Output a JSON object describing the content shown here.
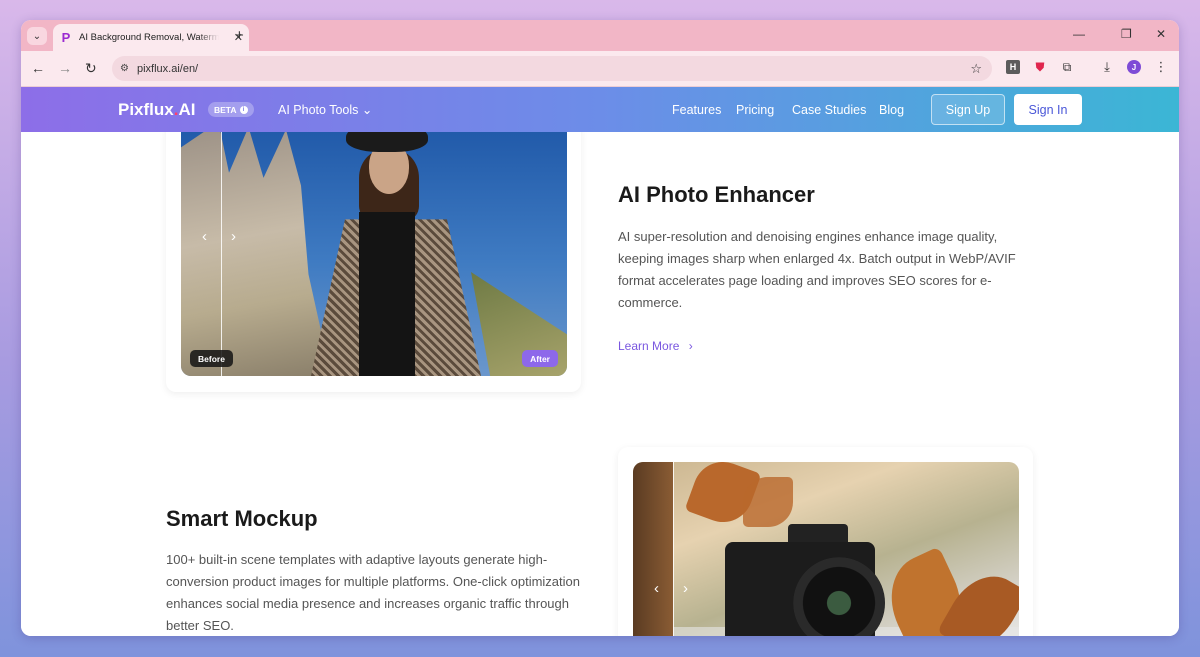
{
  "browser": {
    "tab_title": "AI Background Removal, Watermark",
    "tab_favicon": "P",
    "tab_close": "✕",
    "new_tab": "+",
    "url": "pixflux.ai/en/",
    "window_controls": {
      "minimize": "—",
      "restore": "❐",
      "close": "✕"
    },
    "extensions": {
      "h_label": "H",
      "avatar_initial": "J"
    }
  },
  "site": {
    "logo_text": "Pixflux",
    "logo_dot": ".",
    "logo_suffix": "AI",
    "beta_label": "BETA",
    "tools_menu": "AI Photo Tools",
    "nav": [
      "Features",
      "Pricing",
      "Case Studies",
      "Blog"
    ],
    "sign_up": "Sign Up",
    "sign_in": "Sign In",
    "colors": {
      "accent": "#7a57e0",
      "header_start": "#8d6ee8",
      "header_end": "#3bb6d5"
    }
  },
  "enhancer": {
    "title": "AI Photo Enhancer",
    "description": "AI super-resolution and denoising engines enhance image quality, keeping images sharp when enlarged 4x. Batch output in WebP/AVIF format accelerates page loading and improves SEO scores for e-commerce.",
    "learn_more": "Learn More",
    "before_label": "Before",
    "after_label": "After"
  },
  "mockup": {
    "title": "Smart Mockup",
    "description": "100+ built-in scene templates with adaptive layouts generate high-conversion product images for multiple platforms. One-click optimization enhances social media presence and increases organic traffic through better SEO."
  },
  "icons": {
    "prev": "‹",
    "next": "›",
    "chevron_down": "⌄",
    "learn_more_arrow": "›",
    "back": "←",
    "forward": "→",
    "reload": "↻",
    "star": "☆",
    "download": "⤓",
    "kebab": "⋮",
    "puzzle": "⧉",
    "shield": "⛊",
    "site_info": "⚙"
  }
}
